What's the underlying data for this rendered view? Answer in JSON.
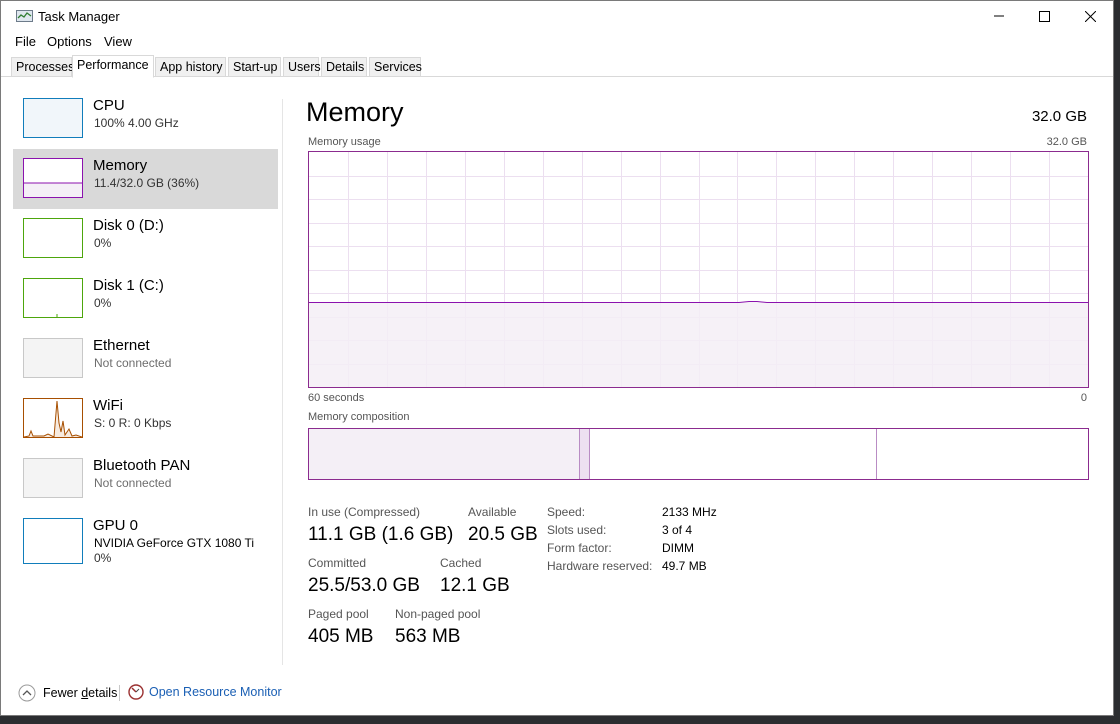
{
  "window": {
    "title": "Task Manager",
    "menu": [
      "File",
      "Options",
      "View"
    ],
    "tabs": [
      "Processes",
      "Performance",
      "App history",
      "Start-up",
      "Users",
      "Details",
      "Services"
    ],
    "active_tab": "Performance"
  },
  "sidebar": {
    "items": [
      {
        "name": "CPU",
        "sub": "100%  4.00 GHz",
        "color": "#117dbb"
      },
      {
        "name": "Memory",
        "sub": "11.4/32.0 GB (36%)",
        "color": "#8b12ae"
      },
      {
        "name": "Disk 0 (D:)",
        "sub": "0%",
        "color": "#4da60c"
      },
      {
        "name": "Disk 1 (C:)",
        "sub": "0%",
        "color": "#4da60c"
      },
      {
        "name": "Ethernet",
        "sub": "Not connected",
        "color": "#c0c0c0"
      },
      {
        "name": "WiFi",
        "sub": "S: 0  R: 0 Kbps",
        "color": "#a74f01"
      },
      {
        "name": "Bluetooth PAN",
        "sub": "Not connected",
        "color": "#c0c0c0"
      },
      {
        "name": "GPU 0",
        "sub": "NVIDIA GeForce GTX 1080 Ti",
        "sub2": "0%",
        "color": "#117dbb"
      }
    ],
    "selected": "Memory"
  },
  "main": {
    "title": "Memory",
    "total": "32.0 GB",
    "usage_label": "Memory usage",
    "usage_max": "32.0 GB",
    "time_label": "60 seconds",
    "zero_label": "0",
    "usage_fraction": 0.36,
    "composition_label": "Memory composition",
    "composition": {
      "in_use": 11.1,
      "modified": 0.4,
      "standby": 11.8,
      "free": 8.7,
      "total": 32.0
    },
    "stats": {
      "in_use_label": "In use (Compressed)",
      "in_use_value": "11.1 GB (1.6 GB)",
      "available_label": "Available",
      "available_value": "20.5 GB",
      "committed_label": "Committed",
      "committed_value": "25.5/53.0 GB",
      "cached_label": "Cached",
      "cached_value": "12.1 GB",
      "paged_label": "Paged pool",
      "paged_value": "405 MB",
      "nonpaged_label": "Non-paged pool",
      "nonpaged_value": "563 MB"
    },
    "details": [
      {
        "key": "Speed:",
        "value": "2133 MHz"
      },
      {
        "key": "Slots used:",
        "value": "3 of 4"
      },
      {
        "key": "Form factor:",
        "value": "DIMM"
      },
      {
        "key": "Hardware reserved:",
        "value": "49.7 MB"
      }
    ]
  },
  "footer": {
    "fewer_details": "Fewer details",
    "fewer_details_accel": "d",
    "open_resource_monitor": "Open Resource Monitor"
  }
}
